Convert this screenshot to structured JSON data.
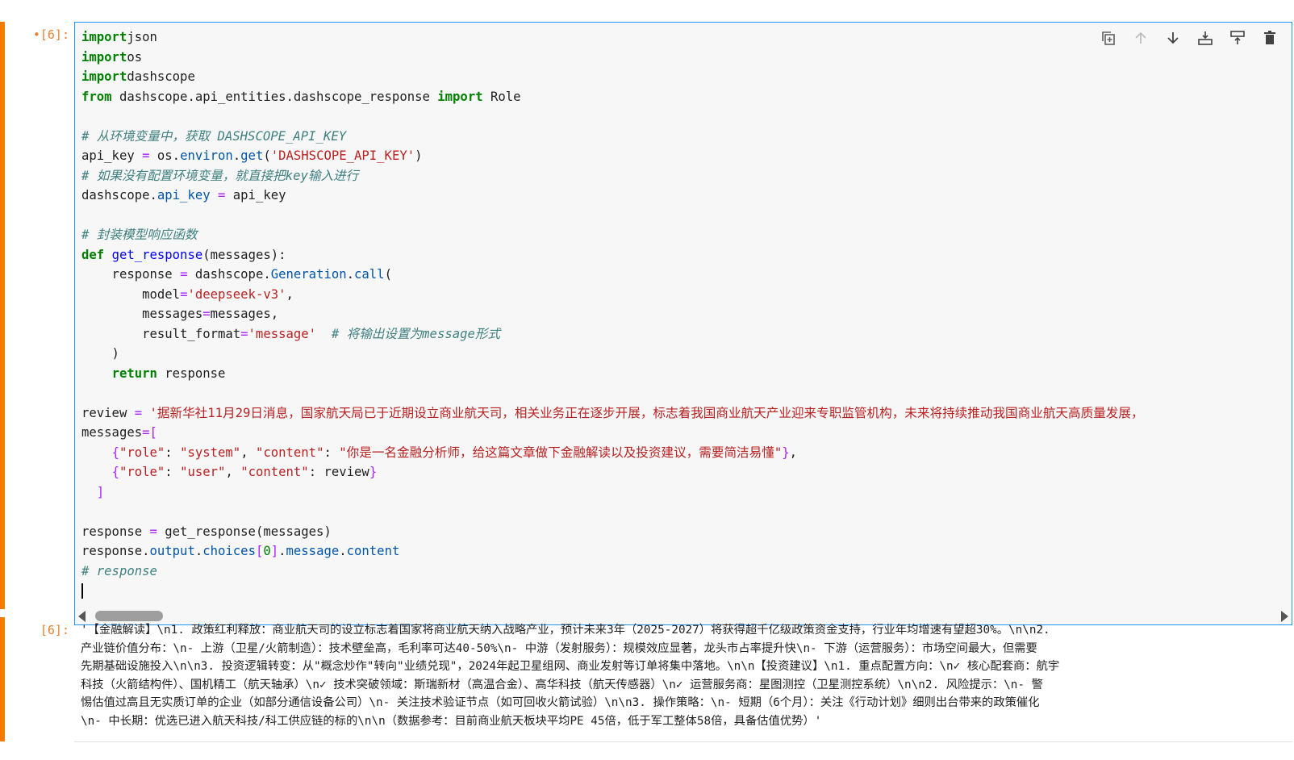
{
  "input_cell": {
    "prompt": "[6]:",
    "prompt_marker": "•",
    "code": [
      [
        [
          "kw",
          "import"
        ],
        [
          "",
          "json"
        ]
      ],
      [
        [
          "kw",
          "import"
        ],
        [
          "",
          "os"
        ]
      ],
      [
        [
          "kw",
          "import"
        ],
        [
          "",
          "dashscope"
        ]
      ],
      [
        [
          "kw",
          "from"
        ],
        [
          "",
          " dashscope.api_entities.dashscope_response "
        ],
        [
          "kw",
          "import"
        ],
        [
          "",
          " Role"
        ]
      ],
      [],
      [
        [
          "com",
          "# 从环境变量中，获取 DASHSCOPE_API_KEY"
        ]
      ],
      [
        [
          "",
          "api_key "
        ],
        [
          "op",
          "="
        ],
        [
          "",
          " os."
        ],
        [
          "attr",
          "environ"
        ],
        [
          "",
          "."
        ],
        [
          "attr",
          "get"
        ],
        [
          "",
          "("
        ],
        [
          "str",
          "'DASHSCOPE_API_KEY'"
        ],
        [
          "",
          ")"
        ]
      ],
      [
        [
          "com",
          "# 如果没有配置环境变量，就直接把key输入进行"
        ]
      ],
      [
        [
          "",
          "dashscope."
        ],
        [
          "attr",
          "api_key"
        ],
        [
          "",
          " "
        ],
        [
          "op",
          "="
        ],
        [
          "",
          " api_key"
        ]
      ],
      [],
      [
        [
          "com",
          "# 封装模型响应函数"
        ]
      ],
      [
        [
          "kw",
          "def"
        ],
        [
          "",
          " "
        ],
        [
          "fn",
          "get_response"
        ],
        [
          "",
          "(messages):"
        ]
      ],
      [
        [
          "",
          "    response "
        ],
        [
          "op",
          "="
        ],
        [
          "",
          " dashscope."
        ],
        [
          "attr",
          "Generation"
        ],
        [
          "",
          "."
        ],
        [
          "attr",
          "call"
        ],
        [
          "",
          "("
        ]
      ],
      [
        [
          "",
          "        model"
        ],
        [
          "op",
          "="
        ],
        [
          "str",
          "'deepseek-v3'"
        ],
        [
          "",
          ","
        ]
      ],
      [
        [
          "",
          "        messages"
        ],
        [
          "op",
          "="
        ],
        [
          "",
          "messages,"
        ]
      ],
      [
        [
          "",
          "        result_format"
        ],
        [
          "op",
          "="
        ],
        [
          "str",
          "'message'"
        ],
        [
          "",
          "  "
        ],
        [
          "com",
          "# 将输出设置为message形式"
        ]
      ],
      [
        [
          "",
          "    )"
        ]
      ],
      [
        [
          "",
          "    "
        ],
        [
          "kw",
          "return"
        ],
        [
          "",
          " response"
        ]
      ],
      [],
      [
        [
          "",
          "review "
        ],
        [
          "op",
          "="
        ],
        [
          "",
          " "
        ],
        [
          "str",
          "'据新华社11月29日消息，国家航天局已于近期设立商业航天司，相关业务正在逐步开展，标志着我国商业航天产业迎来专职监管机构，未来将持续推动我国商业航天高质量发展，"
        ]
      ],
      [
        [
          "",
          "messages"
        ],
        [
          "op",
          "=["
        ]
      ],
      [
        [
          "",
          "    "
        ],
        [
          "op",
          "{"
        ],
        [
          "str",
          "\"role\""
        ],
        [
          "",
          ": "
        ],
        [
          "str",
          "\"system\""
        ],
        [
          "",
          ", "
        ],
        [
          "str",
          "\"content\""
        ],
        [
          "",
          ": "
        ],
        [
          "str",
          "\"你是一名金融分析师，给这篇文章做下金融解读以及投资建议，需要简洁易懂\""
        ],
        [
          "op",
          "}"
        ],
        [
          "",
          ","
        ]
      ],
      [
        [
          "",
          "    "
        ],
        [
          "op",
          "{"
        ],
        [
          "str",
          "\"role\""
        ],
        [
          "",
          ": "
        ],
        [
          "str",
          "\"user\""
        ],
        [
          "",
          ", "
        ],
        [
          "str",
          "\"content\""
        ],
        [
          "",
          ": review"
        ],
        [
          "op",
          "}"
        ]
      ],
      [
        [
          "",
          "  "
        ],
        [
          "op",
          "]"
        ]
      ],
      [],
      [
        [
          "",
          "response "
        ],
        [
          "op",
          "="
        ],
        [
          "",
          " get_response(messages)"
        ]
      ],
      [
        [
          "",
          "response."
        ],
        [
          "attr",
          "output"
        ],
        [
          "",
          "."
        ],
        [
          "attr",
          "choices"
        ],
        [
          "op",
          "["
        ],
        [
          "num",
          "0"
        ],
        [
          "op",
          "]"
        ],
        [
          "",
          "."
        ],
        [
          "attr",
          "message"
        ],
        [
          "",
          "."
        ],
        [
          "attr",
          "content"
        ]
      ],
      [
        [
          "com",
          "# response"
        ]
      ],
      [
        [
          "cursor",
          ""
        ]
      ]
    ]
  },
  "toolbar": {
    "icons": [
      "duplicate-icon",
      "move-up-icon",
      "move-down-icon",
      "insert-above-icon",
      "insert-below-icon",
      "delete-icon"
    ]
  },
  "output_cell": {
    "prompt": "[6]:",
    "lines": [
      "'【金融解读】\\n1. 政策红利释放：商业航天司的设立标志着国家将商业航天纳入战略产业，预计未来3年（2025-2027）将获得超千亿级政策资金支持，行业年均增速有望超30%。\\n\\n2.",
      "产业链价值分布：\\n- 上游（卫星/火箭制造）：技术壁垒高，毛利率可达40-50%\\n- 中游（发射服务）：规模效应显著，龙头市占率提升快\\n- 下游（运营服务）：市场空间最大，但需要",
      "先期基础设施投入\\n\\n3. 投资逻辑转变：从\"概念炒作\"转向\"业绩兑现\"，2024年起卫星组网、商业发射等订单将集中落地。\\n\\n【投资建议】\\n1. 重点配置方向：\\n✓ 核心配套商：航宇",
      "科技（火箭结构件）、国机精工（航天轴承）\\n✓ 技术突破领域：斯瑞新材（高温合金）、高华科技（航天传感器）\\n✓ 运营服务商：星图测控（卫星测控系统）\\n\\n2. 风险提示：\\n- 警",
      "惕估值过高且无实质订单的企业（如部分通信设备公司）\\n- 关注技术验证节点（如可回收火箭试验）\\n\\n3. 操作策略：\\n- 短期（6个月）：关注《行动计划》细则出台带来的政策催化",
      "\\n- 中长期：优选已进入航天科技/科工供应链的标的\\n\\n（数据参考：目前商业航天板块平均PE 45倍，低于军工整体58倍，具备估值优势）'"
    ]
  },
  "colors": {
    "active_cell_bar": "#f57c00",
    "editor_border": "#2196f3",
    "editor_bg": "#f7f7f7",
    "prompt": "#e6822f"
  }
}
